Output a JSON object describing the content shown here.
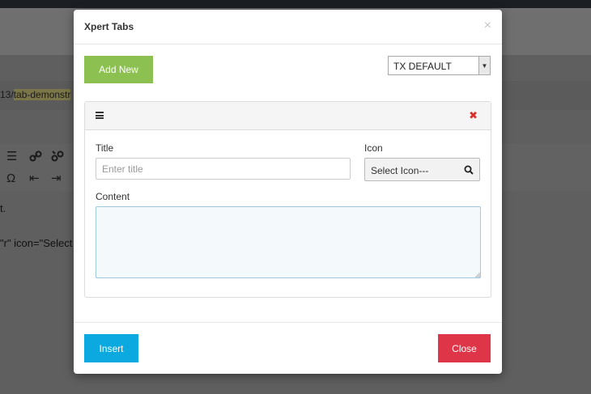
{
  "background": {
    "url_prefix": "13/",
    "url_highlight": "tab-demonstr",
    "line1": "t.",
    "line2": "\"r\" icon=\"Select",
    "toolbar_icons": [
      "align-icon",
      "link-icon",
      "unlink-icon",
      "omega-icon",
      "outdent-icon",
      "indent-icon"
    ]
  },
  "modal": {
    "title": "Xpert Tabs",
    "close_symbol": "×",
    "add_new_label": "Add New",
    "style_select": {
      "selected": "TX DEFAULT"
    },
    "panel": {
      "title_label": "Title",
      "title_placeholder": "Enter title",
      "title_value": "",
      "icon_label": "Icon",
      "icon_select_value": "Select Icon---",
      "content_label": "Content",
      "content_value": ""
    },
    "insert_label": "Insert",
    "close_label": "Close"
  },
  "colors": {
    "add_new": "#8cc152",
    "insert": "#0ca8e0",
    "close": "#de3548",
    "remove": "#d9302c"
  }
}
